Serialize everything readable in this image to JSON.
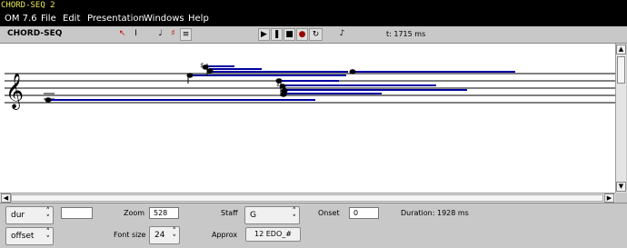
{
  "window": {
    "title": "CHORD-SEQ 2"
  },
  "menu": {
    "items": [
      "OM 7.6",
      "File",
      "Edit",
      "Presentation",
      "Windows",
      "Help"
    ]
  },
  "toolbar": {
    "label": "CHORD-SEQ",
    "time": "t: 1715 ms",
    "tools": [
      "arrow-tool-icon",
      "text-cursor-icon",
      "note-tool-icon",
      "accidental-tool-icon",
      "chord-tool-icon"
    ],
    "transport": [
      "play-icon",
      "pause-icon",
      "stop-icon",
      "record-icon",
      "loop-icon",
      "midi-icon"
    ]
  },
  "score": {
    "clef": "treble",
    "staff_color": "#000000",
    "duration_color": "#0000a0"
  },
  "panel": {
    "display_select": "dur",
    "display_select2": "offset",
    "blank_field": "",
    "zoom_label": "Zoom",
    "zoom_value": "528",
    "fontsize_label": "Font size",
    "fontsize_value": "24",
    "staff_label": "Staff",
    "staff_value": "G",
    "approx_label": "Approx",
    "approx_value": "12 EDO_#",
    "onset_label": "Onset",
    "onset_value": "0",
    "duration_text": "Duration: 1928 ms"
  }
}
